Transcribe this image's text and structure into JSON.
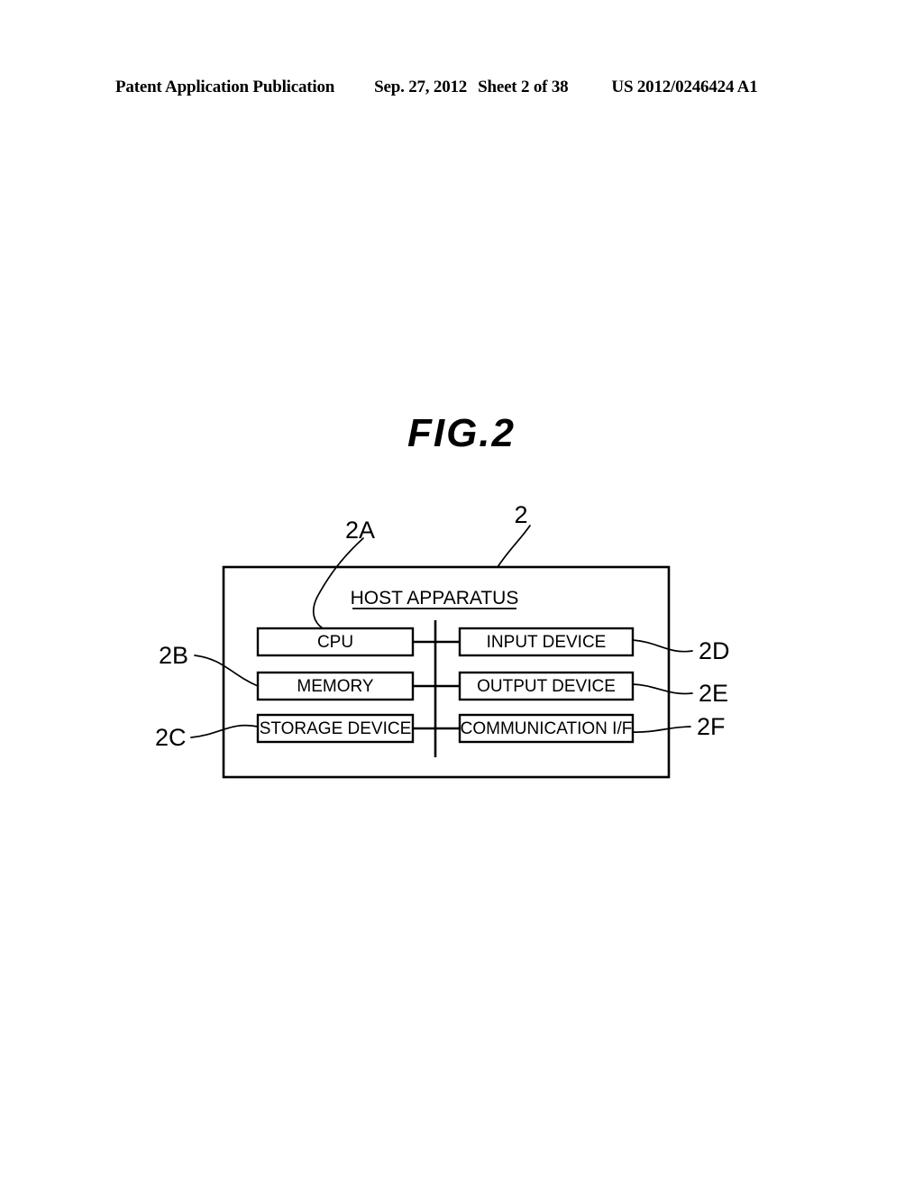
{
  "page": {
    "background_color": "#ffffff",
    "ink_color": "#000000"
  },
  "header": {
    "publication": "Patent Application Publication",
    "date": "Sep. 27, 2012",
    "sheet": "Sheet 2 of 38",
    "document_number": "US 2012/0246424 A1"
  },
  "figure": {
    "title": "FIG.2",
    "container_title": "HOST APPARATUS",
    "container_ref": "2"
  },
  "blocks": {
    "cpu": {
      "label": "CPU",
      "ref": "2A"
    },
    "memory": {
      "label": "MEMORY",
      "ref": "2B"
    },
    "storage": {
      "label": "STORAGE DEVICE",
      "ref": "2C"
    },
    "input": {
      "label": "INPUT DEVICE",
      "ref": "2D"
    },
    "output": {
      "label": "OUTPUT DEVICE",
      "ref": "2E"
    },
    "comm": {
      "label": "COMMUNICATION I/F",
      "ref": "2F"
    }
  },
  "diagram_data": {
    "type": "block-diagram",
    "title": "FIG.2",
    "container": {
      "name": "HOST APPARATUS",
      "ref": "2"
    },
    "nodes": [
      {
        "id": "cpu",
        "label": "CPU",
        "ref": "2A",
        "column": "left",
        "row": 1
      },
      {
        "id": "memory",
        "label": "MEMORY",
        "ref": "2B",
        "column": "left",
        "row": 2
      },
      {
        "id": "storage",
        "label": "STORAGE DEVICE",
        "ref": "2C",
        "column": "left",
        "row": 3
      },
      {
        "id": "input",
        "label": "INPUT DEVICE",
        "ref": "2D",
        "column": "right",
        "row": 1
      },
      {
        "id": "output",
        "label": "OUTPUT DEVICE",
        "ref": "2E",
        "column": "right",
        "row": 2
      },
      {
        "id": "comm",
        "label": "COMMUNICATION I/F",
        "ref": "2F",
        "column": "right",
        "row": 3
      }
    ],
    "bus": {
      "orientation": "vertical",
      "connects": [
        "cpu",
        "memory",
        "storage",
        "input",
        "output",
        "comm"
      ]
    }
  }
}
